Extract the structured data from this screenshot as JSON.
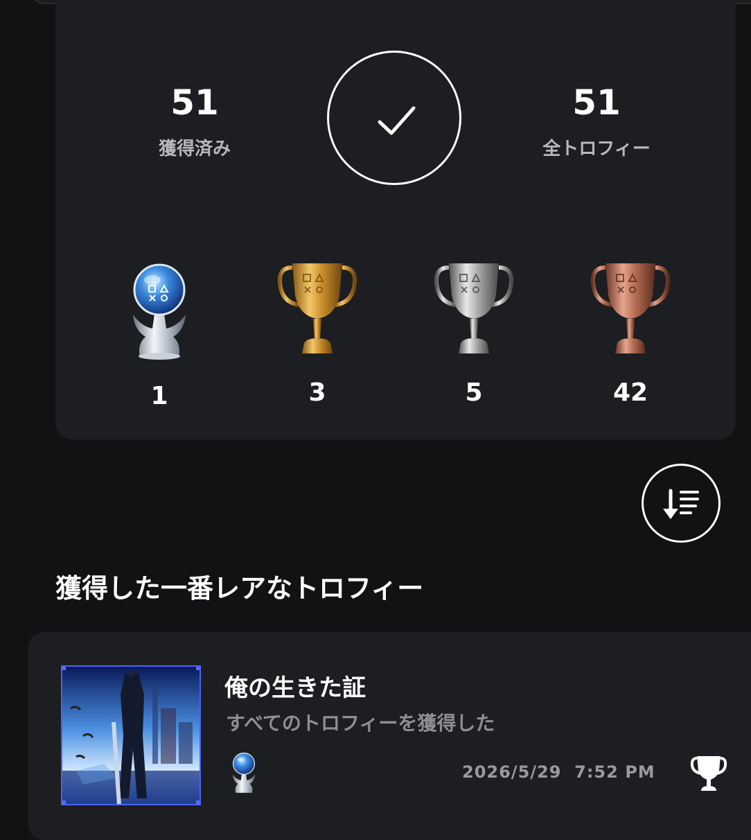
{
  "summary": {
    "earned_count": "51",
    "earned_label": "獲得済み",
    "total_count": "51",
    "total_label": "全トロフィー"
  },
  "trophy_counts": [
    {
      "type": "platinum",
      "icon": "platinum-trophy-icon",
      "count": "1"
    },
    {
      "type": "gold",
      "icon": "gold-trophy-icon",
      "count": "3"
    },
    {
      "type": "silver",
      "icon": "silver-trophy-icon",
      "count": "5"
    },
    {
      "type": "bronze",
      "icon": "bronze-trophy-icon",
      "count": "42"
    }
  ],
  "rarest_section": {
    "title": "獲得した一番レアなトロフィー",
    "trophy": {
      "name": "俺の生きた証",
      "description": "すべてのトロフィーを獲得した",
      "date": "2026/5/29  7:52 PM",
      "grade_icon": "platinum-trophy-icon"
    }
  },
  "icons": {
    "completion": "checkmark-icon",
    "sort": "sort-descending-icon",
    "trophy_list": "trophy-cup-icon"
  },
  "colors": {
    "background": "#121214",
    "card": "#1d1e21",
    "muted_text": "#b8b8bb",
    "thumb_border": "#4f62f3"
  }
}
